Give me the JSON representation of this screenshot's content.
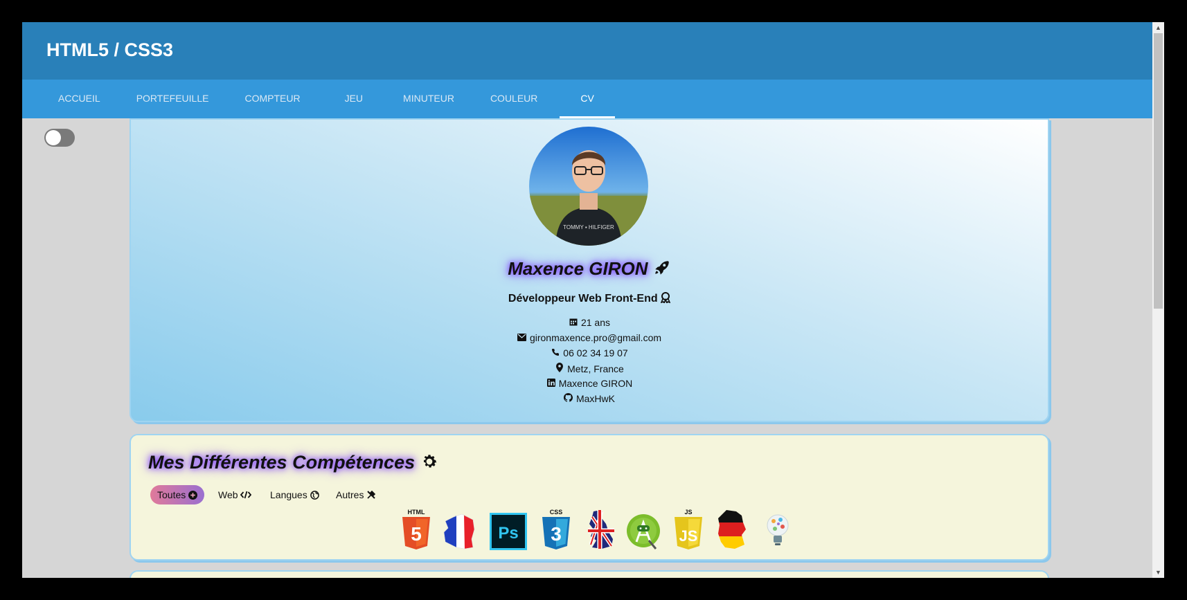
{
  "header": {
    "title": "HTML5 / CSS3"
  },
  "nav": {
    "tabs": [
      {
        "label": "ACCUEIL"
      },
      {
        "label": "PORTEFEUILLE"
      },
      {
        "label": "COMPTEUR"
      },
      {
        "label": "JEU"
      },
      {
        "label": "MINUTEUR"
      },
      {
        "label": "COULEUR"
      },
      {
        "label": "CV"
      }
    ],
    "active_tab": "CV"
  },
  "theme_toggle": {
    "state": "off"
  },
  "profile": {
    "name": "Maxence GIRON",
    "name_icon": "rocket-icon",
    "role": "Développeur Web Front-End",
    "role_icon": "award-icon",
    "age": "21 ans",
    "email": "gironmaxence.pro@gmail.com",
    "phone": "06 02 34 19 07",
    "location": "Metz, France",
    "linkedin": "Maxence GIRON",
    "github": "MaxHwK"
  },
  "skills": {
    "title": "Mes Différentes Compétences",
    "title_icon": "gear-icon",
    "filters": [
      {
        "label": "Toutes",
        "icon": "plus-circle-icon",
        "active": true
      },
      {
        "label": "Web",
        "icon": "code-icon",
        "active": false
      },
      {
        "label": "Langues",
        "icon": "globe-icon",
        "active": false
      },
      {
        "label": "Autres",
        "icon": "tools-icon",
        "active": false
      }
    ],
    "items": [
      {
        "name": "html5-logo",
        "caption": "HTML",
        "glyph": "5"
      },
      {
        "name": "france-flag-map"
      },
      {
        "name": "photoshop-logo",
        "glyph": "Ps"
      },
      {
        "name": "css3-logo",
        "caption": "CSS",
        "glyph": "3"
      },
      {
        "name": "uk-flag-map"
      },
      {
        "name": "android-studio-logo"
      },
      {
        "name": "javascript-logo",
        "caption": "JS",
        "glyph": "JS"
      },
      {
        "name": "germany-flag-map"
      },
      {
        "name": "lightbulb-icon"
      }
    ]
  },
  "colors": {
    "header": "#2980b9",
    "nav": "#3498db",
    "page_bg": "#d6d6d6",
    "card_beige": "#f5f5dc",
    "glow": "#7d3cff"
  }
}
